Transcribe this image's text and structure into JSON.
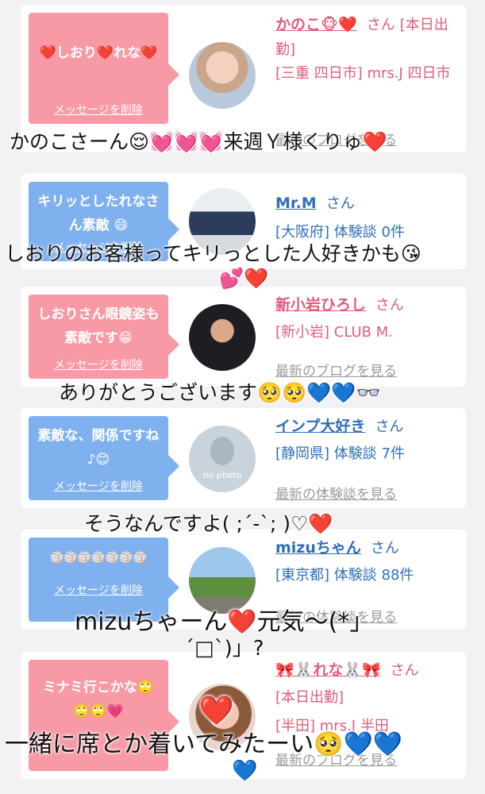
{
  "cards": [
    {
      "bubble": "❤️しおり❤️れな❤️",
      "delete_label": "メッセージを削除",
      "name": "かのこ🐵❤️",
      "san": "さん",
      "badge": "[本日出勤]",
      "location": "[三重 四日市] mrs.J 四日市",
      "link": "最新のブログを見る"
    },
    {
      "bubble": "キリッとしたれなさん素敵 😄",
      "delete_label": "メッセージを削除",
      "name": "Mr.M",
      "san": "さん",
      "location": "[大阪府] 体験談 0件",
      "link": ""
    },
    {
      "bubble": "しおりさん眼鏡姿も素敵です😁",
      "delete_label": "メッセージを削除",
      "name": "新小岩ひろし",
      "san": "さん",
      "location": "[新小岩] CLUB M.",
      "link": "最新のブログを見る"
    },
    {
      "bubble": "素敵な、関係ですね♪😊",
      "delete_label": "メッセージを削除",
      "avatar_text": "no photo",
      "name": "インプ大好き",
      "san": "さん",
      "location": "[静岡県] 体験談 7件",
      "link": "最新の体験談を見る"
    },
    {
      "bubble": "🏐🏐🏐🏐🏐🏐🏐",
      "delete_label": "メッセージを削除",
      "name": "mizuちゃん",
      "san": "さん",
      "location": "[東京都] 体験談 88件",
      "link": "最新の体験談を見る"
    },
    {
      "bubble": "ミナミ行こかな🙄🙄🙄💗",
      "delete_label": "",
      "name": "🎀🐰れな🐰🎀",
      "san": "さん",
      "badge": "[本日出勤]",
      "location": "[半田] mrs.J 半田",
      "link": "最新のブログを見る"
    }
  ],
  "overlays": [
    "かのこさーん😌💓💓💓来週Ｙ様くりゅ❤️",
    "しおりのお客様ってキリっとした人好きかも😘",
    "💕❤️",
    "ありがとうございます🥺🥺💙💙👓",
    "そうなんですよ( ;´-`; )♡❤️",
    "mizuちゃーん❤️元気〜(*」",
    "´□`)」?",
    "❤️",
    "一緒に席とか着いてみたーい🥺💙💙",
    "💙"
  ]
}
